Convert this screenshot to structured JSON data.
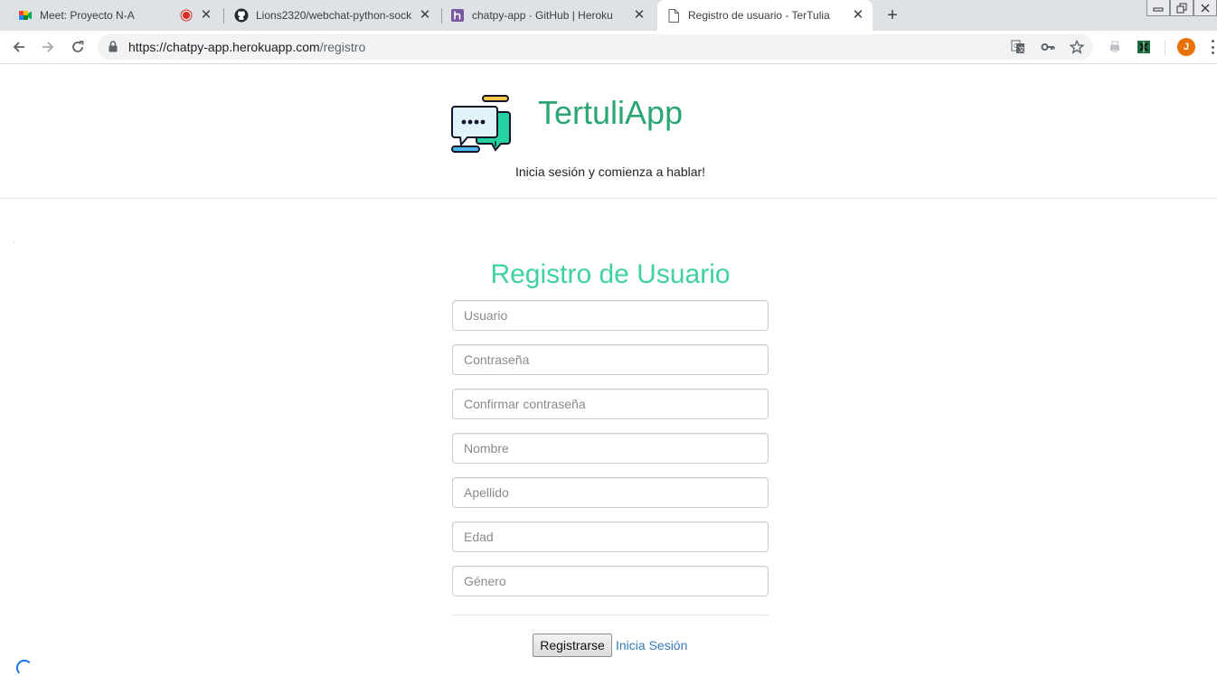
{
  "browser": {
    "tabs": [
      {
        "title": "Meet: Proyecto N-A",
        "favicon": "google-meet-icon",
        "recording": true
      },
      {
        "title": "Lions2320/webchat-python-sock",
        "favicon": "github-icon"
      },
      {
        "title": "chatpy-app · GitHub | Heroku",
        "favicon": "heroku-icon"
      },
      {
        "title": "Registro de usuario - TerTulia",
        "favicon": "page-icon",
        "active": true
      }
    ],
    "url_host": "https://chatpy-app.herokuapp.com",
    "url_path": "/registro",
    "profile_initial": "J",
    "profile_color": "#e8710a"
  },
  "header": {
    "brand": "TertuliApp",
    "tagline": "Inicia sesión y comienza a hablar!",
    "brand_color": "#2aa672"
  },
  "form": {
    "title": "Registro de Usuario",
    "title_color": "#3fd0a3",
    "fields": {
      "usuario": {
        "placeholder": "Usuario",
        "value": ""
      },
      "contrasena": {
        "placeholder": "Contraseña",
        "value": ""
      },
      "confirmar": {
        "placeholder": "Confirmar contraseña",
        "value": ""
      },
      "nombre": {
        "placeholder": "Nombre",
        "value": ""
      },
      "apellido": {
        "placeholder": "Apellido",
        "value": ""
      },
      "edad": {
        "placeholder": "Edad",
        "value": ""
      },
      "genero": {
        "placeholder": "Género",
        "value": ""
      }
    },
    "submit_label": "Registrarse",
    "login_link": "Inicia Sesión",
    "link_color": "#337ab7"
  }
}
